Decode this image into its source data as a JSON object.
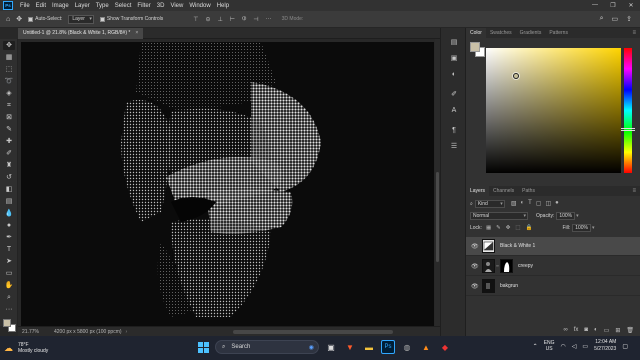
{
  "app": {
    "logo_text": "Ps"
  },
  "menu": {
    "items": [
      "File",
      "Edit",
      "Image",
      "Layer",
      "Type",
      "Select",
      "Filter",
      "3D",
      "View",
      "Window",
      "Help"
    ],
    "window_controls": [
      "—",
      "❐",
      "✕"
    ]
  },
  "options_bar": {
    "auto_select_label": "Auto-Select:",
    "auto_select_value": "Layer",
    "show_transform_label": "Show Transform Controls",
    "mode_3d_label": "3D Mode:"
  },
  "document": {
    "tab_title": "Untitled-1 @ 21.8% (Black & White 1, RGB/8#) *",
    "close_glyph": "×"
  },
  "status": {
    "zoom": "21.77%",
    "doc_info": "4200 px x 5800 px (100 ppcm)",
    "arrow": "›"
  },
  "color_panel": {
    "tabs": [
      "Color",
      "Swatches",
      "Gradients",
      "Patterns"
    ],
    "active_tab": "Color",
    "foreground": "#c9c0a7",
    "background": "#ffffff",
    "hue_color": "#ffd400"
  },
  "layers_panel": {
    "tabs": [
      "Layers",
      "Channels",
      "Paths"
    ],
    "active_tab": "Layers",
    "filter_value": "Kind",
    "blend_mode": "Normal",
    "opacity_label": "Opacity:",
    "opacity_value": "100%",
    "lock_label": "Lock:",
    "fill_label": "Fill:",
    "fill_value": "100%",
    "layers": [
      {
        "name": "Black & White 1",
        "selected": true,
        "type": "adjustment"
      },
      {
        "name": "creepy",
        "selected": false,
        "type": "masked"
      },
      {
        "name": "bakgrun",
        "selected": false,
        "type": "image"
      }
    ]
  },
  "taskbar": {
    "weather_temp": "78°F",
    "weather_desc": "Mostly cloudy",
    "search_label": "Search",
    "lang_line1": "ENG",
    "lang_line2": "US",
    "time": "12:04 AM",
    "date": "5/27/2023"
  }
}
